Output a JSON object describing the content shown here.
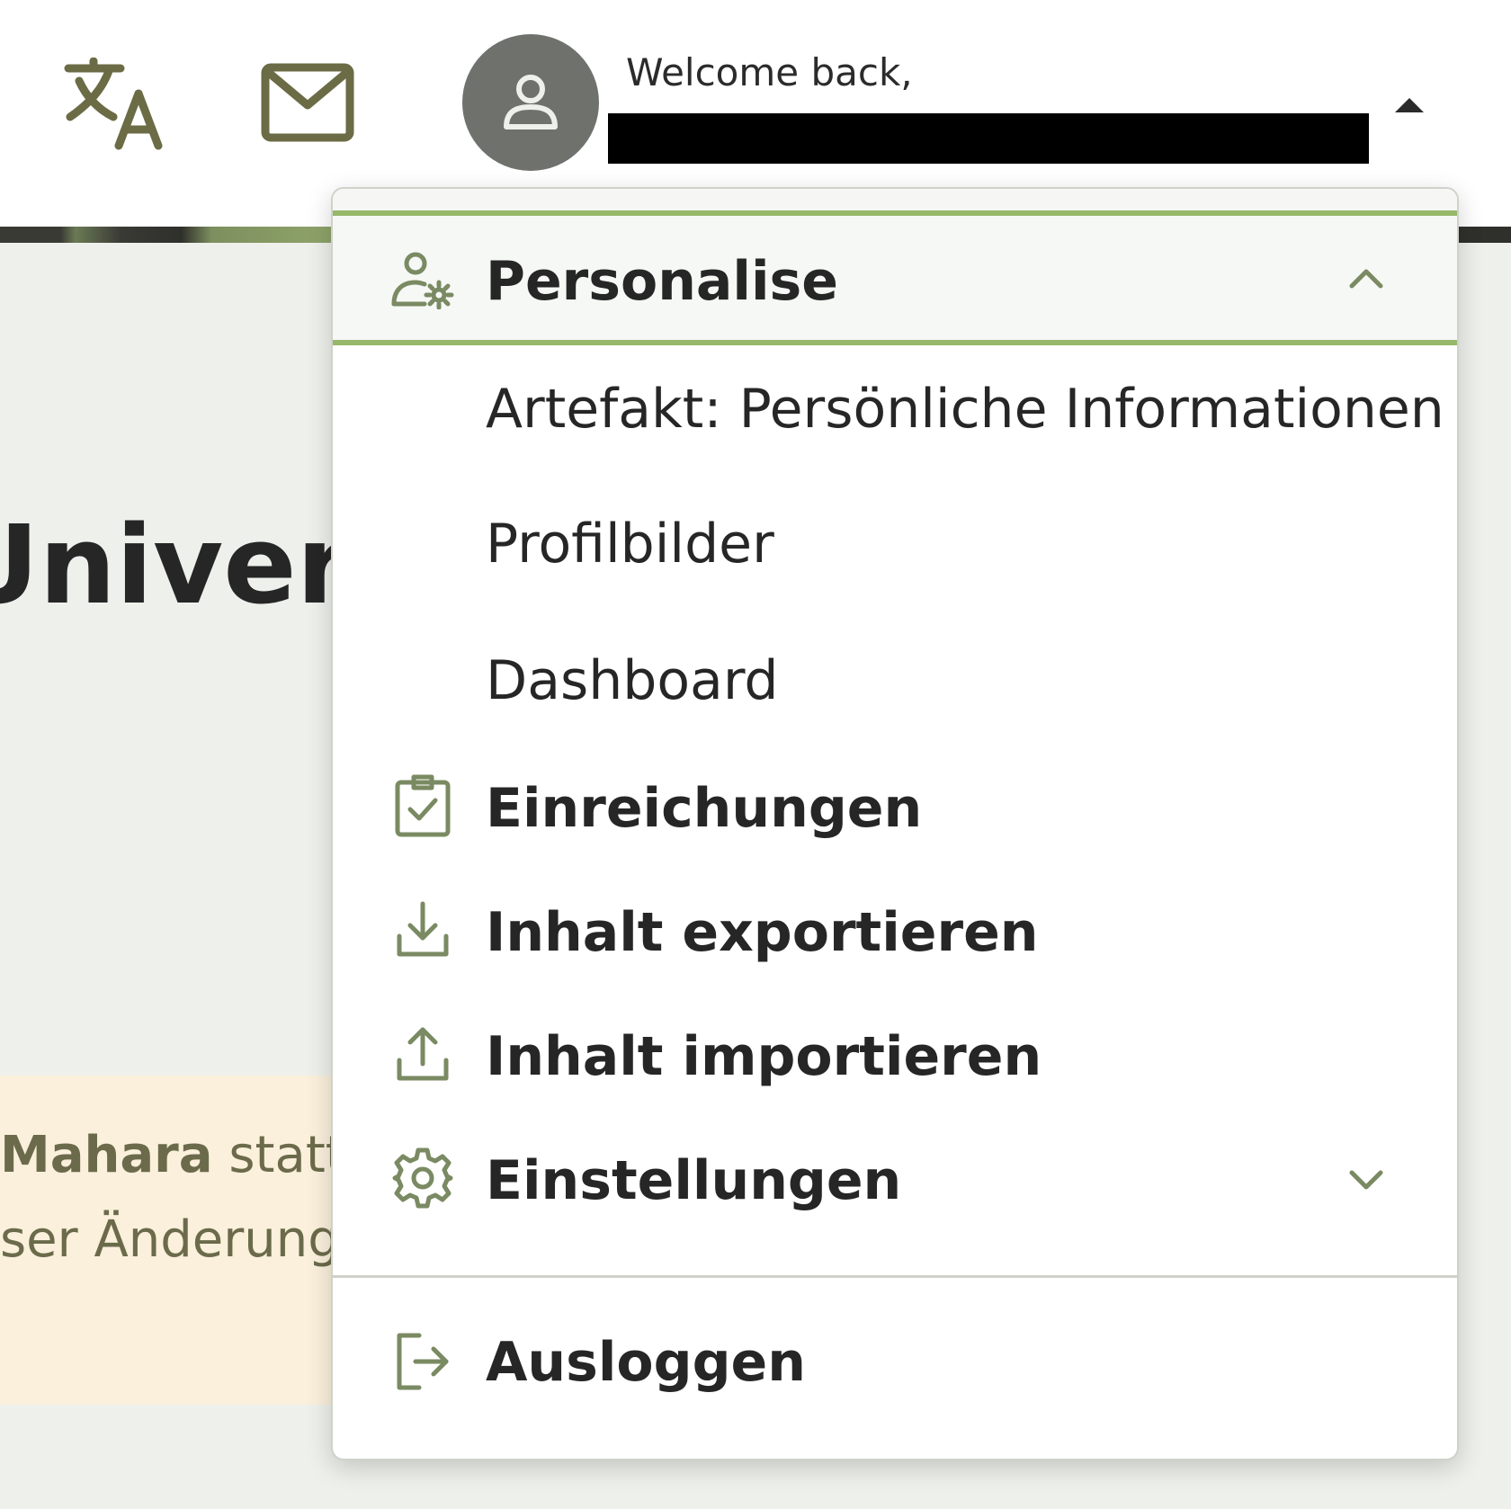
{
  "header": {
    "translate_icon": "translate-icon",
    "mail_icon": "mail-icon",
    "avatar_icon": "user-icon",
    "welcome_text": "Welcome back,",
    "user_menu_caret": "caret-up-icon"
  },
  "background": {
    "page_heading": "Univers",
    "notice_bold": "Mahara",
    "notice_rest": " statt",
    "notice_line2": "ser Änderung"
  },
  "menu": {
    "section_title": "Personalise",
    "section_icon": "user-settings-icon",
    "section_chevron": "chevron-up-icon",
    "sub_items": [
      {
        "label": "Artefakt: Persönliche Informationen"
      },
      {
        "label": "Profilbilder"
      },
      {
        "label": "Dashboard"
      }
    ],
    "items": [
      {
        "label": "Einreichungen",
        "icon": "clipboard-check-icon"
      },
      {
        "label": "Inhalt exportieren",
        "icon": "download-icon"
      },
      {
        "label": "Inhalt importieren",
        "icon": "upload-icon"
      },
      {
        "label": "Einstellungen",
        "icon": "gear-icon",
        "chevron": "chevron-down-icon"
      }
    ],
    "logout": {
      "label": "Ausloggen",
      "icon": "logout-icon"
    }
  },
  "colors": {
    "accent_green": "#97b86a",
    "icon_olive": "#6b6b45",
    "icon_sage": "#7a8a62",
    "avatar_bg": "#6e716c",
    "notice_bg": "#faf0dc"
  }
}
